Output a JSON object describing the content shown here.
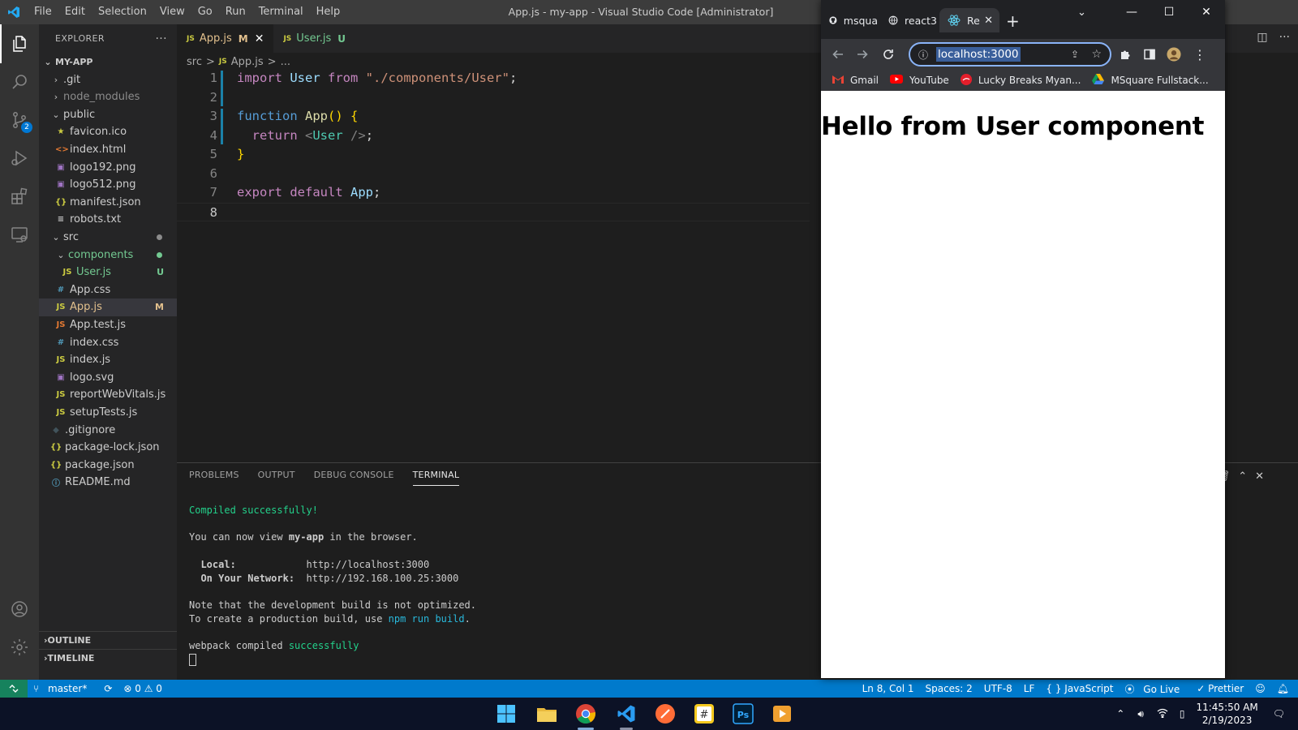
{
  "window": {
    "title": "App.js - my-app - Visual Studio Code [Administrator]",
    "menu": [
      "File",
      "Edit",
      "Selection",
      "View",
      "Go",
      "Run",
      "Terminal",
      "Help"
    ]
  },
  "explorer": {
    "header": "EXPLORER",
    "more": "···",
    "project": "MY-APP",
    "items": [
      {
        "label": ".git",
        "depth": 1,
        "kind": "folder-closed"
      },
      {
        "label": "node_modules",
        "depth": 1,
        "kind": "folder-closed",
        "dim": true
      },
      {
        "label": "public",
        "depth": 1,
        "kind": "folder-open"
      },
      {
        "label": "favicon.ico",
        "depth": 2,
        "icon": "★",
        "iconColor": "#cbcb41"
      },
      {
        "label": "index.html",
        "depth": 2,
        "icon": "<>",
        "iconColor": "#e37933"
      },
      {
        "label": "logo192.png",
        "depth": 2,
        "icon": "▣",
        "iconColor": "#a074c4"
      },
      {
        "label": "logo512.png",
        "depth": 2,
        "icon": "▣",
        "iconColor": "#a074c4"
      },
      {
        "label": "manifest.json",
        "depth": 2,
        "icon": "{}",
        "iconColor": "#cbcb41"
      },
      {
        "label": "robots.txt",
        "depth": 2,
        "icon": "≡",
        "iconColor": "#cccccc"
      },
      {
        "label": "src",
        "depth": 1,
        "kind": "folder-open",
        "dot": "#8c8c8c"
      },
      {
        "label": "components",
        "depth": 2,
        "kind": "folder-open",
        "color": "#73c991",
        "dot": "#73c991"
      },
      {
        "label": "User.js",
        "depth": 3,
        "icon": "JS",
        "iconColor": "#cbcb41",
        "color": "#73c991",
        "deco": "U",
        "decoColor": "#73c991"
      },
      {
        "label": "App.css",
        "depth": 2,
        "icon": "#",
        "iconColor": "#519aba"
      },
      {
        "label": "App.js",
        "depth": 2,
        "icon": "JS",
        "iconColor": "#cbcb41",
        "color": "#e2c08d",
        "deco": "M",
        "decoColor": "#e2c08d",
        "selected": true
      },
      {
        "label": "App.test.js",
        "depth": 2,
        "icon": "JS",
        "iconColor": "#e37933"
      },
      {
        "label": "index.css",
        "depth": 2,
        "icon": "#",
        "iconColor": "#519aba"
      },
      {
        "label": "index.js",
        "depth": 2,
        "icon": "JS",
        "iconColor": "#cbcb41"
      },
      {
        "label": "logo.svg",
        "depth": 2,
        "icon": "▣",
        "iconColor": "#a074c4"
      },
      {
        "label": "reportWebVitals.js",
        "depth": 2,
        "icon": "JS",
        "iconColor": "#cbcb41"
      },
      {
        "label": "setupTests.js",
        "depth": 2,
        "icon": "JS",
        "iconColor": "#cbcb41"
      },
      {
        "label": ".gitignore",
        "depth": 1,
        "icon": "◆",
        "iconColor": "#41535b"
      },
      {
        "label": "package-lock.json",
        "depth": 1,
        "icon": "{}",
        "iconColor": "#cbcb41"
      },
      {
        "label": "package.json",
        "depth": 1,
        "icon": "{}",
        "iconColor": "#cbcb41"
      },
      {
        "label": "README.md",
        "depth": 1,
        "icon": "ⓘ",
        "iconColor": "#519aba"
      }
    ],
    "outline": "OUTLINE",
    "timeline": "TIMELINE"
  },
  "editor": {
    "tabs": [
      {
        "icon": "JS",
        "label": "App.js",
        "status": "M",
        "statusColor": "#e2c08d",
        "color": "#e2c08d",
        "active": true
      },
      {
        "icon": "JS",
        "label": "User.js",
        "status": "U",
        "statusColor": "#73c991",
        "color": "#73c991",
        "active": false
      }
    ],
    "breadcrumb": [
      "src",
      ">",
      "JS",
      "App.js",
      ">",
      "..."
    ],
    "lines": [
      [
        [
          "import ",
          "k-purple"
        ],
        [
          "User ",
          "k-var"
        ],
        [
          "from ",
          "k-purple"
        ],
        [
          "\"./components/User\"",
          "k-str"
        ],
        [
          ";",
          "k-punc"
        ]
      ],
      [],
      [
        [
          "function ",
          "k-blue"
        ],
        [
          "App",
          "k-fn"
        ],
        [
          "() ",
          "k-br"
        ],
        [
          "{",
          "k-br"
        ]
      ],
      [
        [
          "  return ",
          "k-purple"
        ],
        [
          "<",
          "k-gray"
        ],
        [
          "User ",
          "k-tag"
        ],
        [
          "/>",
          "k-gray"
        ],
        [
          ";",
          "k-punc"
        ]
      ],
      [
        [
          "}",
          "k-br"
        ]
      ],
      [],
      [
        [
          "export ",
          "k-purple"
        ],
        [
          "default ",
          "k-purple"
        ],
        [
          "App",
          "k-var"
        ],
        [
          ";",
          "k-punc"
        ]
      ],
      []
    ],
    "current_line": 8
  },
  "panel": {
    "tabs": [
      "PROBLEMS",
      "OUTPUT",
      "DEBUG CONSOLE",
      "TERMINAL"
    ],
    "active_tab": "TERMINAL",
    "terminal": [
      [
        [
          "Compiled successfully!",
          "t-green"
        ]
      ],
      [],
      [
        [
          "You can now view ",
          ""
        ],
        [
          "my-app",
          "t-bold"
        ],
        [
          " in the browser.",
          ""
        ]
      ],
      [],
      [
        [
          "  Local:            ",
          "t-bold"
        ],
        [
          "http://localhost:3000",
          ""
        ]
      ],
      [
        [
          "  On Your Network:  ",
          "t-bold"
        ],
        [
          "http://192.168.100.25:3000",
          ""
        ]
      ],
      [],
      [
        [
          "Note that the development build is not optimized.",
          ""
        ]
      ],
      [
        [
          "To create a production build, use ",
          ""
        ],
        [
          "npm run build",
          "t-cyan"
        ],
        [
          ".",
          ""
        ]
      ],
      [],
      [
        [
          "webpack compiled ",
          ""
        ],
        [
          "successfully",
          "t-green"
        ]
      ],
      [
        [
          "█",
          ""
        ]
      ]
    ]
  },
  "statusbar": {
    "branch": "master*",
    "sync": "⟳",
    "errors": "⊗ 0 ⚠ 0",
    "position": "Ln 8, Col 1",
    "spaces": "Spaces: 2",
    "encoding": "UTF-8",
    "eol": "LF",
    "language": "{ } JavaScript",
    "golive": "Go Live",
    "prettier": "✓ Prettier"
  },
  "browser": {
    "tabs": [
      {
        "icon": "github-icon",
        "label": "msqua"
      },
      {
        "icon": "globe-icon",
        "label": "react3"
      },
      {
        "icon": "react-icon",
        "label": "Re"
      }
    ],
    "url": "localhost:3000",
    "bookmarks": [
      {
        "icon": "gmail-icon",
        "label": "Gmail"
      },
      {
        "icon": "youtube-icon",
        "label": "YouTube"
      },
      {
        "icon": "cocacola-icon",
        "label": "Lucky Breaks Myan..."
      },
      {
        "icon": "drive-icon",
        "label": "MSquare Fullstack..."
      }
    ],
    "heading": "Hello from User component"
  },
  "taskbar": {
    "time": "11:45:50 AM",
    "date": "2/19/2023"
  }
}
